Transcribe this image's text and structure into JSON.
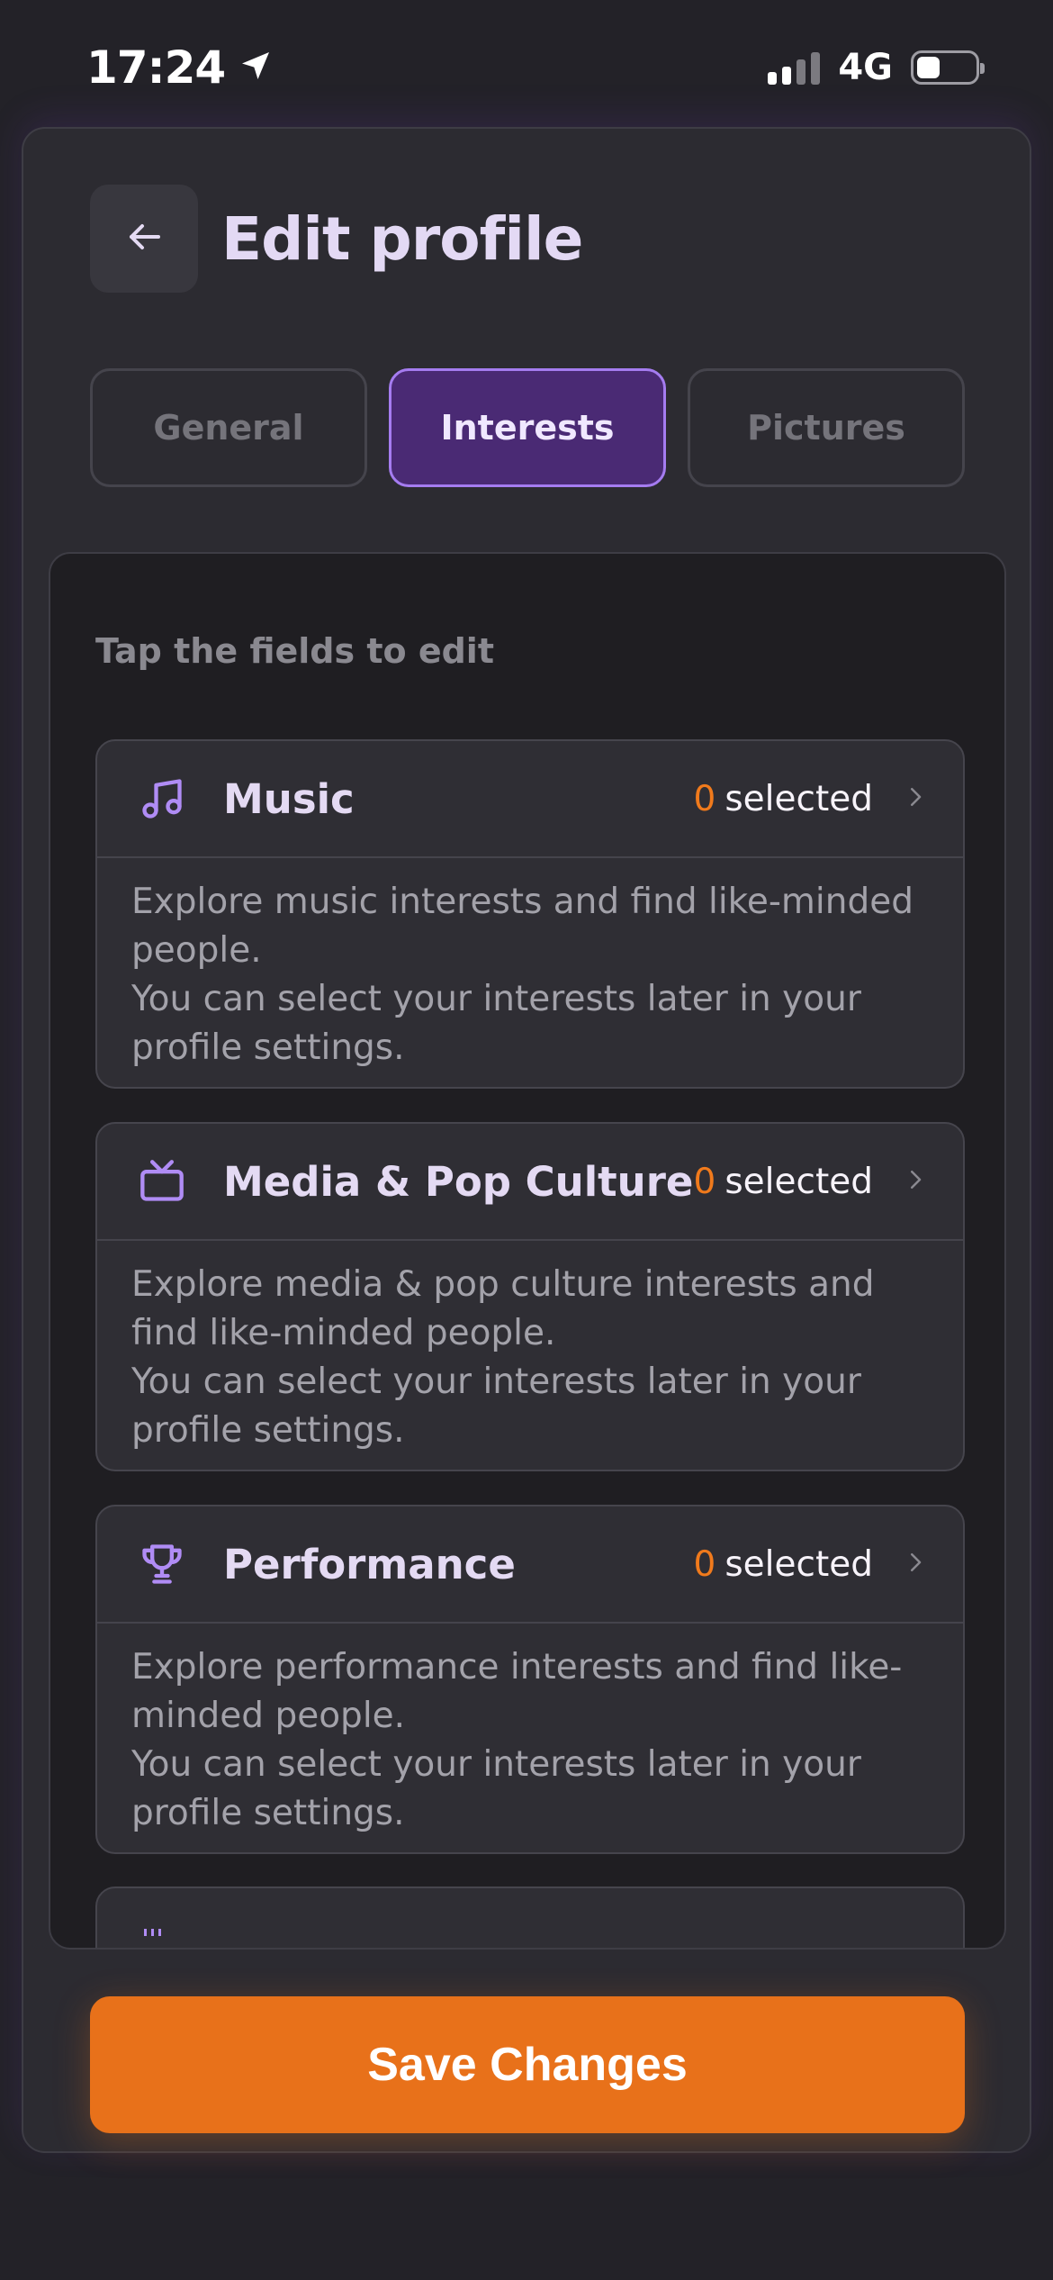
{
  "status_bar": {
    "time": "17:24",
    "network": "4G"
  },
  "header": {
    "title": "Edit profile"
  },
  "tabs": [
    {
      "label": "General",
      "active": false
    },
    {
      "label": "Interests",
      "active": true
    },
    {
      "label": "Pictures",
      "active": false
    }
  ],
  "hint": "Tap the fields to edit",
  "categories": [
    {
      "icon": "music-note-icon",
      "title": "Music",
      "count": "0",
      "count_suffix": "selected",
      "desc_line1": "Explore music interests and find like-minded people.",
      "desc_line2": "You can select your interests later in your profile settings."
    },
    {
      "icon": "tv-icon",
      "title": "Media & Pop Culture",
      "count": "0",
      "count_suffix": "selected",
      "desc_line1": "Explore media & pop culture interests and find like-minded people.",
      "desc_line2": "You can select your interests later in your profile settings."
    },
    {
      "icon": "trophy-icon",
      "title": "Performance",
      "count": "0",
      "count_suffix": "selected",
      "desc_line1": "Explore performance interests and find like-minded people.",
      "desc_line2": "You can select your interests later in your profile settings."
    }
  ],
  "save_button": {
    "label": "Save Changes"
  },
  "colors": {
    "accent": "#e8711a",
    "active_tab": "#4a2a74",
    "icon": "#b08cf5",
    "count": "#f07a1c"
  }
}
